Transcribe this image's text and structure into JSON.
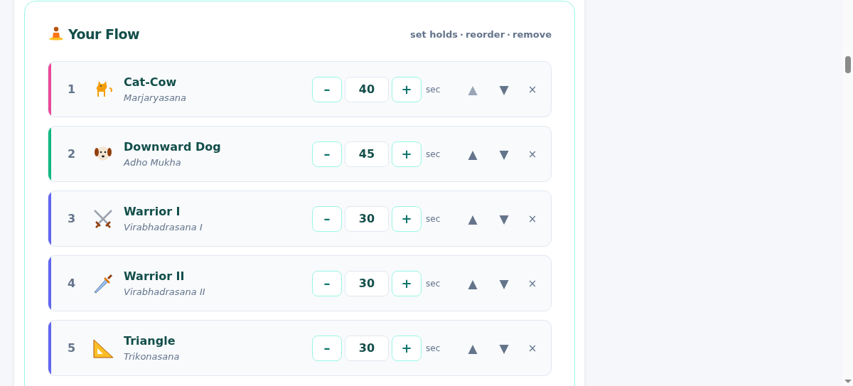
{
  "flow": {
    "title": "Your Flow",
    "hint_links": [
      {
        "label": "set holds"
      },
      {
        "label": "reorder"
      },
      {
        "label": "remove"
      }
    ],
    "separator": "·",
    "poses": [
      {
        "number": "1",
        "kind": "cat",
        "color": "#ec4899",
        "name": "Cat-Cow",
        "sanskrit": "Marjaryasana",
        "minus": "–",
        "seconds": "40",
        "plus": "+",
        "unit": "sec",
        "up": "▲",
        "up_disabled": true,
        "down": "▼",
        "remove": "×"
      },
      {
        "number": "2",
        "kind": "dog",
        "color": "#10b981",
        "name": "Downward Dog",
        "sanskrit": "Adho Mukha",
        "minus": "–",
        "seconds": "45",
        "plus": "+",
        "unit": "sec",
        "up": "▲",
        "up_disabled": false,
        "down": "▼",
        "remove": "×"
      },
      {
        "number": "3",
        "kind": "swords",
        "color": "#6366f1",
        "name": "Warrior I",
        "sanskrit": "Virabhadrasana I",
        "minus": "–",
        "seconds": "30",
        "plus": "+",
        "unit": "sec",
        "up": "▲",
        "up_disabled": false,
        "down": "▼",
        "remove": "×"
      },
      {
        "number": "4",
        "kind": "dagger",
        "color": "#6366f1",
        "name": "Warrior II",
        "sanskrit": "Virabhadrasana II",
        "minus": "–",
        "seconds": "30",
        "plus": "+",
        "unit": "sec",
        "up": "▲",
        "up_disabled": false,
        "down": "▼",
        "remove": "×"
      },
      {
        "number": "5",
        "kind": "ruler",
        "color": "#6366f1",
        "name": "Triangle",
        "sanskrit": "Trikonasana",
        "minus": "–",
        "seconds": "30",
        "plus": "+",
        "unit": "sec",
        "up": "▲",
        "up_disabled": false,
        "down": "▼",
        "remove": "×"
      }
    ]
  }
}
